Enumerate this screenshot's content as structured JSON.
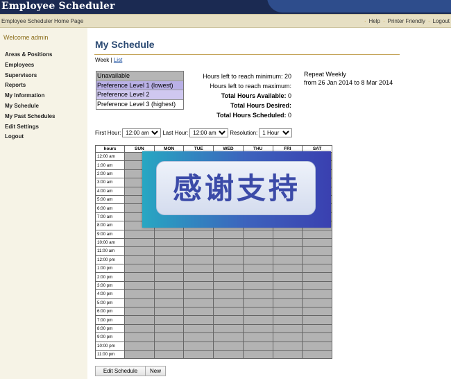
{
  "header": {
    "app_title": "Employee Scheduler"
  },
  "navbar": {
    "home_link": "Employee Scheduler Home Page",
    "links": [
      "Help",
      "Printer Friendly",
      "Logout"
    ]
  },
  "sidebar": {
    "welcome": "Welcome admin",
    "items": [
      "Areas & Positions",
      "Employees",
      "Supervisors",
      "Reports",
      "My Information",
      "My Schedule",
      "My Past Schedules",
      "Edit Settings",
      "Logout"
    ]
  },
  "main": {
    "page_title": "My Schedule",
    "view_week": "Week",
    "view_sep": " | ",
    "view_list": "List",
    "legend": [
      "Unavailable",
      "Preference Level 1 (lowest)",
      "Preference Level 2",
      "Preference Level 3 (highest)"
    ],
    "hours_stats": [
      {
        "label": "Hours left to reach minimum:",
        "value": "20"
      },
      {
        "label": "Hours left to reach maximum:",
        "value": ""
      },
      {
        "label": "Total Hours Available:",
        "value": "0"
      },
      {
        "label": "Total Hours Desired:",
        "value": ""
      },
      {
        "label": "Total Hours Scheduled:",
        "value": "0"
      }
    ],
    "repeat_label": "Repeat Weekly",
    "repeat_range": "from 26 Jan 2014 to 8 Mar 2014",
    "controls": {
      "first_hour_label": "First Hour:",
      "first_hour_value": "12:00 am",
      "last_hour_label": "Last Hour:",
      "last_hour_value": "12:00 am",
      "resolution_label": "Resolution:",
      "resolution_value": "1 Hour"
    },
    "grid": {
      "hours_header": "hours",
      "days": [
        "SUN",
        "MON",
        "TUE",
        "WED",
        "THU",
        "FRI",
        "SAT"
      ],
      "rows": [
        "12:00 am",
        "1:00 am",
        "2:00 am",
        "3:00 am",
        "4:00 am",
        "5:00 am",
        "6:00 am",
        "7:00 am",
        "8:00 am",
        "9:00 am",
        "10:00 am",
        "11:00 am",
        "12:00 pm",
        "1:00 pm",
        "2:00 pm",
        "3:00 pm",
        "4:00 pm",
        "5:00 pm",
        "6:00 pm",
        "7:00 pm",
        "8:00 pm",
        "9:00 pm",
        "10:00 pm",
        "11:00 pm"
      ]
    },
    "buttons": {
      "edit": "Edit Schedule",
      "new": "New"
    }
  },
  "overlay": {
    "text": "感谢支持"
  },
  "colors": {
    "header_bg": "#1b2a52",
    "navbar_bg": "#e6dfc3",
    "sidebar_bg": "#f6f3e6",
    "title_color": "#2b4a73",
    "unavailable": "#b5b5b5",
    "pref1": "#b9b0e6",
    "pref2": "#cfc8f0",
    "pref3": "#ffffff"
  }
}
